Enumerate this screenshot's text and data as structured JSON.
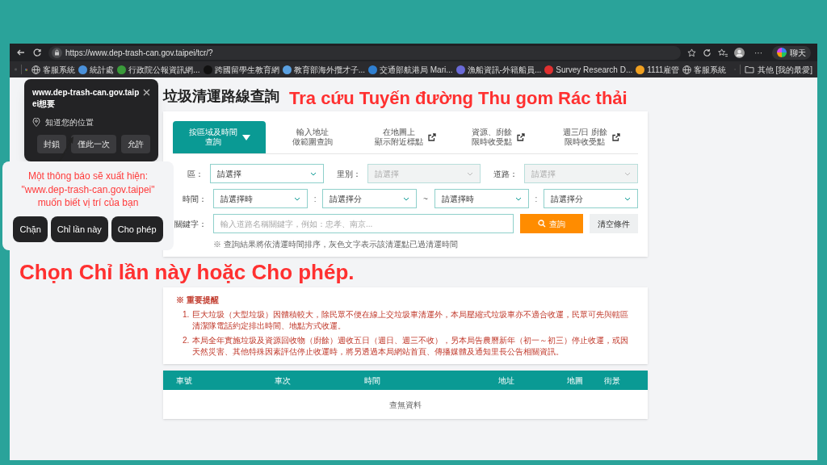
{
  "browser": {
    "url": "https://www.dep-trash-can.gov.taipei/tcr/?",
    "more": "···",
    "chat": "聊天",
    "other_bookmarks": "其他 [我的最愛]",
    "bookmarks": [
      {
        "label": "客服系統",
        "kind": "globe"
      },
      {
        "label": "統計處",
        "kind": "favicon",
        "color": "#4a90d9"
      },
      {
        "label": "行政院公報資訊網...",
        "kind": "favicon",
        "color": "#3a9a3a"
      },
      {
        "label": "跨國留學生教育網",
        "kind": "favicon",
        "color": "#111111"
      },
      {
        "label": "教育部海外攬才子...",
        "kind": "favicon",
        "color": "#5aa0e0"
      },
      {
        "label": "交通部航港局 Mari...",
        "kind": "favicon",
        "color": "#2f7fd0"
      },
      {
        "label": "漁船資訊-外籍船員...",
        "kind": "favicon",
        "color": "#6a6ad8"
      },
      {
        "label": "Survey Research D...",
        "kind": "favicon",
        "color": "#e03030"
      },
      {
        "label": "1111雇管",
        "kind": "favicon",
        "color": "#f0a020"
      },
      {
        "label": "客服系統",
        "kind": "globe"
      }
    ]
  },
  "permission_popup": {
    "site": "www.dep-trash-can.gov.taipei想要",
    "permission": "知道您的位置",
    "buttons": [
      "封鎖",
      "僅此一次",
      "允許"
    ]
  },
  "page": {
    "title": "垃圾清運路線查詢",
    "translated_title": "Tra cứu Tuyến đường Thu gom Rác thải",
    "tabs": [
      {
        "lines": [
          "按區域及時間",
          "查詢"
        ],
        "selected": true,
        "external": false
      },
      {
        "lines": [
          "輸入地址",
          "做範圍查詢"
        ],
        "selected": false,
        "external": false
      },
      {
        "lines": [
          "在地圖上",
          "顯示附近標點"
        ],
        "selected": false,
        "external": true
      },
      {
        "lines": [
          "資源、廚餘",
          "限時收受點"
        ],
        "selected": false,
        "external": true
      },
      {
        "lines": [
          "週三/日 廚餘",
          "限時收受點"
        ],
        "selected": false,
        "external": true
      }
    ],
    "area_filters": [
      {
        "label": "區：",
        "placeholder": "請選擇",
        "disabled": false
      },
      {
        "label": "里別：",
        "placeholder": "請選擇",
        "disabled": true
      },
      {
        "label": "道路：",
        "placeholder": "請選擇",
        "disabled": true
      }
    ],
    "time_filter": {
      "label": "時間：",
      "selects": [
        {
          "placeholder": "請選擇時",
          "separator": ":"
        },
        {
          "placeholder": "請選擇分",
          "separator": "~"
        },
        {
          "placeholder": "請選擇時",
          "separator": ":"
        },
        {
          "placeholder": "請選擇分"
        }
      ]
    },
    "keyword": {
      "label": "關鍵字：",
      "placeholder": "輸入道路名稱關鍵字，例如：忠孝、南京...",
      "search_button": "查詢",
      "clear_button": "清空條件"
    },
    "sort_note": "※ 查詢結果將依清運時間排序，灰色文字表示該清運點已過清運時間",
    "notice": {
      "heading": "※ 重要提醒",
      "items": [
        {
          "number": "1.",
          "text": "巨大垃圾（大型垃圾）因體積較大，除民眾不便在線上交垃圾車清運外，本局壓縮式垃圾車亦不適合收運，民眾可先與轄區清潔隊電話約定排出時間、地點方式收運。"
        },
        {
          "number": "2.",
          "text": "本局全年實施垃圾及資源回收物（廚餘）週收五日（週日、週三不收），另本局告農曆新年（初一～初三）停止收運，或因天然災害、其他特殊因素評估停止收運時，將另透過本局網站首頁、傳播媒體及通知里長公告相關資訊。"
        }
      ]
    },
    "table": {
      "columns": [
        "車號",
        "車次",
        "時間",
        "地址",
        "地圖",
        "街景"
      ],
      "empty": "查無資料"
    }
  },
  "annotation": {
    "callout": "Một thông báo sẽ xuất hiện: \"www.dep-trash-can.gov.taipei\" muốn biết vị trí của bạn",
    "callout_buttons": [
      "Chặn",
      "Chỉ lần này",
      "Cho phép"
    ],
    "instruction": "Chọn Chỉ lần này hoặc Cho phép."
  }
}
